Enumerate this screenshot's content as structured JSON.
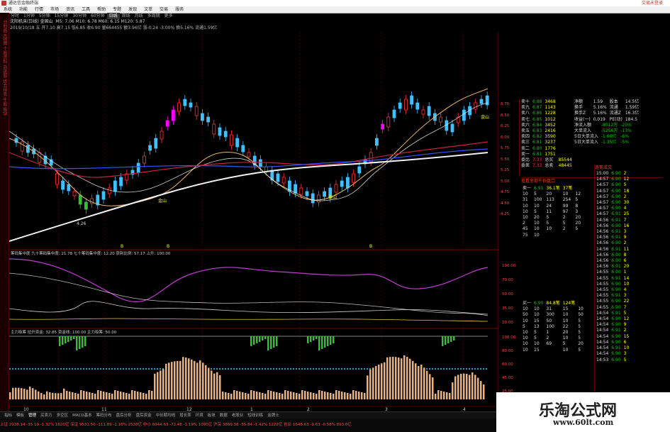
{
  "window": {
    "title": "通达信金融终端",
    "right_text": "交易未登录"
  },
  "menu": [
    "系统",
    "功能",
    "行情",
    "市场",
    "资讯",
    "工具",
    "帮助",
    "专题",
    "发现",
    "文萃",
    "交易",
    "服务"
  ],
  "tabs": [
    "分时",
    "1分钟",
    "5分钟",
    "15分钟",
    "30分钟",
    "60分钟",
    "日线",
    "周线",
    "月线",
    "多周期",
    "更多"
  ],
  "selected_tab": "日线",
  "chart": {
    "header1": "沈阳机床(日线) 金固山",
    "ma": "M5: 7.06  M10: 6.78  M60: 6.15  M120: 5.87",
    "header2": "2019/10/18 五 开7.10 高7.15 低6.85 收6.90 量664455 额3.96亿 涨-0.24 -3.00% 换5.16% 流通1.59亿",
    "price_labels": [
      "6.75",
      "6.50",
      "6.25",
      "6.00",
      "5.75",
      "5.50",
      "5.25",
      "5.00",
      "4.75",
      "4.50",
      "4.25"
    ],
    "labels": {
      "jinshan1": "金山",
      "jinshan2": "金山",
      "jinshan3": "金山",
      "low": "4.26",
      "b1": "B",
      "b2": "B",
      "b3": "B"
    },
    "ind1_header": "筹码集中度 九十筹码集中度: 21.78  七十筹码集中度: 12.20  获利比例: 57.17  上升: 100.00",
    "ind1_scale": [
      "100.00",
      "70.00",
      "50.00",
      "35.00",
      "20.00"
    ],
    "ind2_header": "主力吸筹 拉升资金: 32.85  资金线: 100.00  主力吸筹: 50.00",
    "ind2_scale": [
      "100.00",
      "80.00",
      "60.00",
      "45.00",
      "25.00"
    ],
    "axis": [
      "10",
      "11",
      "12",
      "1",
      "2",
      "3",
      "4"
    ]
  },
  "right": {
    "sell": [
      [
        "卖十",
        "6.88",
        "3468"
      ],
      [
        "卖九",
        "6.87",
        "1143"
      ],
      [
        "卖八",
        "6.86",
        "1228"
      ],
      [
        "卖七",
        "6.85",
        "1012"
      ],
      [
        "卖六",
        "6.84",
        "3452"
      ],
      [
        "卖五",
        "6.83",
        "2416"
      ],
      [
        "卖四",
        "6.82",
        "3590"
      ],
      [
        "卖三",
        "6.81",
        "3237"
      ],
      [
        "卖二",
        "6.80",
        "1776"
      ],
      [
        "卖一",
        "6.81",
        "1751"
      ]
    ],
    "stats": [
      [
        "净额",
        "1.59",
        "股本",
        "14.5亿"
      ],
      [
        "换手",
        "5.16%",
        "流通",
        "1.59亿"
      ],
      [
        "换手Z",
        "5.16%",
        "流通Z",
        "16.3亿"
      ],
      [
        "收益(一)",
        "0.019",
        "PE(动)",
        "184.5"
      ]
    ],
    "flows": [
      [
        "净流入额",
        "-8012万",
        "-20%"
      ],
      [
        "大单流入",
        "-5256万",
        "-13%"
      ],
      [
        "5日大单流入",
        "-1.60亿",
        "-6%"
      ],
      [
        "5日大单流入",
        "-1.35亿",
        "-5%"
      ]
    ],
    "wb": [
      [
        "委比",
        "7.33",
        "总买",
        "85544"
      ],
      [
        "委差",
        "7.33",
        "总卖",
        "48445"
      ]
    ],
    "queue_title": "查看全部千档盘口",
    "sell_queue_head": [
      "卖一",
      "6.91",
      "36.1笔",
      "37笔"
    ],
    "buy_queue_head": [
      "买一",
      "6.90",
      "84.8笔",
      "124笔"
    ],
    "q1": [
      [
        "10",
        "5",
        "20",
        "10",
        "12"
      ],
      [
        "31",
        "100",
        "113",
        "254",
        "5"
      ],
      [
        "10",
        "10",
        "24",
        "99",
        "8"
      ],
      [
        "10",
        "5",
        "11",
        "97",
        "3"
      ],
      [
        "10",
        "20",
        "5",
        "2",
        "20"
      ],
      [
        "2",
        "10",
        "5",
        "5",
        "20"
      ],
      [
        "45",
        "10",
        "10",
        "2",
        "5"
      ],
      [
        "75",
        "10",
        "",
        "",
        ""
      ]
    ],
    "q2": [
      [
        "10",
        "10",
        "31",
        "15",
        "10"
      ],
      [
        "50",
        "10",
        "300",
        "10",
        "50"
      ],
      [
        "10",
        "15",
        "50",
        "10",
        "5"
      ],
      [
        "5",
        "13",
        "100",
        "22",
        "5"
      ],
      [
        "10",
        "5",
        "1",
        "20",
        "5"
      ],
      [
        "10",
        "5",
        "2",
        "10",
        "5"
      ],
      [
        "10",
        "10",
        "69",
        "5",
        "20"
      ],
      [
        "10",
        "15",
        "",
        "10",
        "5"
      ]
    ],
    "ticks_title": "逐笔成交",
    "ticks": [
      [
        "15:00",
        "6.90",
        "2"
      ],
      [
        "14:57",
        "6.90",
        "12"
      ],
      [
        "14:57",
        "6.90",
        "5"
      ],
      [
        "14:57",
        "6.90",
        "18"
      ],
      [
        "14:57",
        "6.90",
        "2"
      ],
      [
        "14:57",
        "6.90",
        "30"
      ],
      [
        "14:57",
        "6.90",
        "4"
      ],
      [
        "14:57",
        "6.91",
        "25"
      ],
      [
        "14:56",
        "6.91",
        "7"
      ],
      [
        "14:56",
        "6.90",
        "16"
      ],
      [
        "14:56",
        "6.91",
        "3"
      ],
      [
        "14:56",
        "6.91",
        "9"
      ],
      [
        "14:56",
        "6.90",
        "2"
      ],
      [
        "14:56",
        "6.91",
        "11"
      ],
      [
        "14:56",
        "6.90",
        "8"
      ],
      [
        "14:56",
        "6.90",
        "6"
      ],
      [
        "14:56",
        "6.91",
        "20"
      ],
      [
        "14:55",
        "6.90",
        "1"
      ],
      [
        "14:55",
        "6.91",
        "14"
      ],
      [
        "14:55",
        "6.90",
        "10"
      ],
      [
        "14:55",
        "6.90",
        "4"
      ],
      [
        "14:55",
        "6.91",
        "3"
      ],
      [
        "14:55",
        "6.90",
        "22"
      ],
      [
        "14:55",
        "6.90",
        "7"
      ],
      [
        "14:54",
        "6.91",
        "5"
      ],
      [
        "14:54",
        "6.90",
        "12"
      ],
      [
        "14:54",
        "6.90",
        "9"
      ],
      [
        "14:54",
        "6.91",
        "2"
      ],
      [
        "14:54",
        "6.90",
        "15"
      ],
      [
        "14:54",
        "6.90",
        "6"
      ],
      [
        "14:54",
        "6.91",
        "10"
      ],
      [
        "14:54",
        "6.90",
        "3"
      ],
      [
        "14:53",
        "6.90",
        "5"
      ]
    ]
  },
  "bottom_tabs": [
    "指标",
    "模板",
    "管理",
    "买卖力",
    "多空区",
    "MACD基本",
    "筹码分布",
    "盘后分析",
    "盘后资金",
    "中长期均线",
    "增长率",
    "环境",
    "板块",
    "数据",
    "老股业",
    "短线训练",
    "金牌士"
  ],
  "status": [
    "上证 2938.14 -35.19 -1.32% 1620亿",
    "深证 9531.50 -111.89 -1.16% 2538亿",
    "中小 6044.63 -72.48 -1.19% 1090亿",
    "沪深 3869.38 -55.84 -1.42% 1222亿",
    "创业 1648.63 -9.63 -0.58% 893.0亿"
  ],
  "watermark": {
    "brand": "乐淘公式网",
    "url": "www.60lt.com"
  },
  "colors": {
    "up": "#ff3333",
    "down": "#00cc00",
    "magenta": "#ff00ff",
    "cyan": "#44ddff"
  }
}
